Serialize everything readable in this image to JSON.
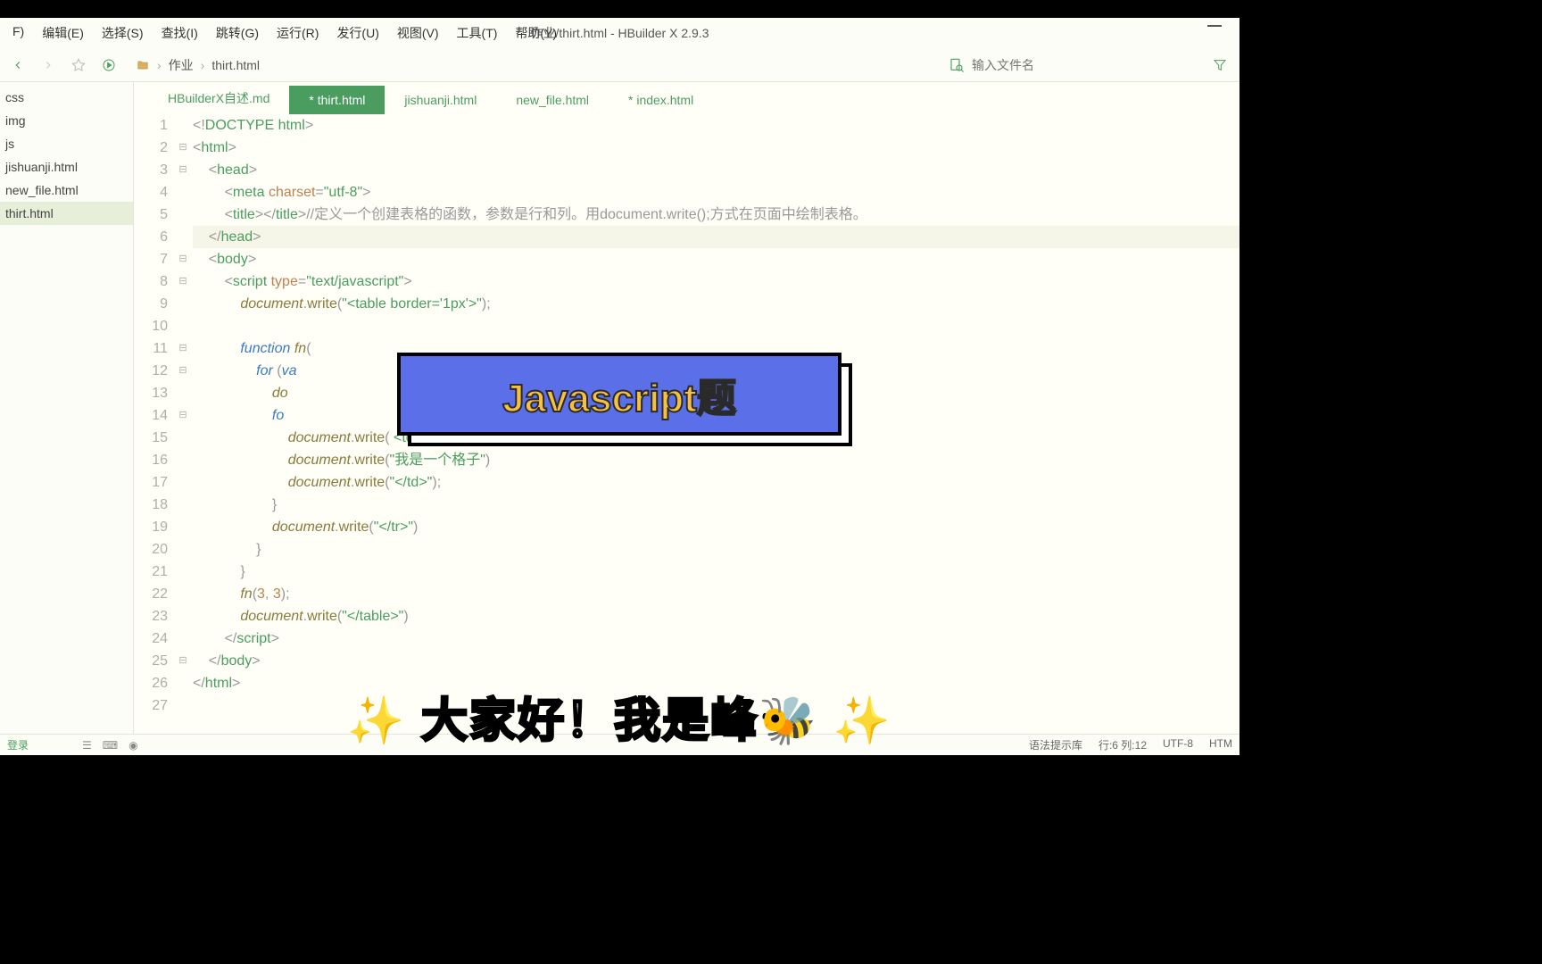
{
  "window": {
    "title": "作业/thirt.html - HBuilder X 2.9.3"
  },
  "menu": [
    "F)",
    "编辑(E)",
    "选择(S)",
    "查找(I)",
    "跳转(G)",
    "运行(R)",
    "发行(U)",
    "视图(V)",
    "工具(T)",
    "帮助(Y)"
  ],
  "breadcrumb": [
    "作业",
    "thirt.html"
  ],
  "search": {
    "placeholder": "输入文件名"
  },
  "sidebar": {
    "items": [
      "css",
      "img",
      "js",
      "jishuanji.html",
      "new_file.html",
      "thirt.html"
    ],
    "active_index": 5
  },
  "tabs": [
    {
      "label": "HBuilderX自述.md",
      "active": false
    },
    {
      "label": "* thirt.html",
      "active": true
    },
    {
      "label": "jishuanji.html",
      "active": false
    },
    {
      "label": "new_file.html",
      "active": false
    },
    {
      "label": "* index.html",
      "active": false
    }
  ],
  "code": {
    "lines": [
      {
        "n": 1,
        "fold": "",
        "html": "<span class='t-punct'>&lt;!</span><span class='t-tag'>DOCTYPE html</span><span class='t-punct'>&gt;</span>"
      },
      {
        "n": 2,
        "fold": "⊟",
        "html": "<span class='t-punct'>&lt;</span><span class='t-tag'>html</span><span class='t-punct'>&gt;</span>"
      },
      {
        "n": 3,
        "fold": "⊟",
        "html": "    <span class='t-punct'>&lt;</span><span class='t-tag'>head</span><span class='t-punct'>&gt;</span>"
      },
      {
        "n": 4,
        "fold": "",
        "html": "        <span class='t-punct'>&lt;</span><span class='t-tag'>meta</span> <span class='t-attr'>charset</span><span class='t-punct'>=</span><span class='t-str'>\"utf-8\"</span><span class='t-punct'>&gt;</span>"
      },
      {
        "n": 5,
        "fold": "",
        "html": "        <span class='t-punct'>&lt;</span><span class='t-tag'>title</span><span class='t-punct'>&gt;&lt;/</span><span class='t-tag'>title</span><span class='t-punct'>&gt;</span><span class='t-comment'>//定义一个创建表格的函数，参数是行和列。用document.write();方式在页面中绘制表格。</span>"
      },
      {
        "n": 6,
        "fold": "",
        "html": "    <span class='t-punct'>&lt;/</span><span class='t-tag'>head</span><span class='t-punct'>&gt;</span>",
        "cursor": true
      },
      {
        "n": 7,
        "fold": "⊟",
        "html": "    <span class='t-punct'>&lt;</span><span class='t-tag'>body</span><span class='t-punct'>&gt;</span>"
      },
      {
        "n": 8,
        "fold": "⊟",
        "html": "        <span class='t-punct'>&lt;</span><span class='t-tag'>script</span> <span class='t-attr'>type</span><span class='t-punct'>=</span><span class='t-str'>\"text/javascript\"</span><span class='t-punct'>&gt;</span>"
      },
      {
        "n": 9,
        "fold": "",
        "html": "            <span class='t-obj'>document</span><span class='t-punct'>.</span><span class='t-method'>write</span><span class='t-punct'>(</span><span class='t-str'>\"&lt;table border='1px'&gt;\"</span><span class='t-punct'>);</span>"
      },
      {
        "n": 10,
        "fold": "",
        "html": ""
      },
      {
        "n": 11,
        "fold": "⊟",
        "html": "            <span class='t-kw'>function</span> <span class='t-func'>fn</span><span class='t-punct'>(</span>"
      },
      {
        "n": 12,
        "fold": "⊟",
        "html": "                <span class='t-kw'>for</span> <span class='t-punct'>(</span><span class='t-kw'>va</span>"
      },
      {
        "n": 13,
        "fold": "",
        "html": "                    <span class='t-obj'>do</span>"
      },
      {
        "n": 14,
        "fold": "⊟",
        "html": "                    <span class='t-kw'>fo</span>"
      },
      {
        "n": 15,
        "fold": "",
        "html": "                        <span class='t-obj'>document</span><span class='t-punct'>.</span><span class='t-method'>write</span><span class='t-punct'>(</span> <span class='t-str'>&lt;td&gt;</span> <span class='t-punct'>);</span>"
      },
      {
        "n": 16,
        "fold": "",
        "html": "                        <span class='t-obj'>document</span><span class='t-punct'>.</span><span class='t-method'>write</span><span class='t-punct'>(</span><span class='t-str'>\"我是一个格子\"</span><span class='t-punct'>)</span>"
      },
      {
        "n": 17,
        "fold": "",
        "html": "                        <span class='t-obj'>document</span><span class='t-punct'>.</span><span class='t-method'>write</span><span class='t-punct'>(</span><span class='t-str'>\"&lt;/td&gt;\"</span><span class='t-punct'>);</span>"
      },
      {
        "n": 18,
        "fold": "",
        "html": "                    <span class='t-punct'>}</span>"
      },
      {
        "n": 19,
        "fold": "",
        "html": "                    <span class='t-obj'>document</span><span class='t-punct'>.</span><span class='t-method'>write</span><span class='t-punct'>(</span><span class='t-str'>\"&lt;/tr&gt;\"</span><span class='t-punct'>)</span>"
      },
      {
        "n": 20,
        "fold": "",
        "html": "                <span class='t-punct'>}</span>"
      },
      {
        "n": 21,
        "fold": "",
        "html": "            <span class='t-punct'>}</span>"
      },
      {
        "n": 22,
        "fold": "",
        "html": "            <span class='t-func'>fn</span><span class='t-punct'>(</span><span class='t-num'>3</span><span class='t-punct'>,</span> <span class='t-num'>3</span><span class='t-punct'>);</span>"
      },
      {
        "n": 23,
        "fold": "",
        "html": "            <span class='t-obj'>document</span><span class='t-punct'>.</span><span class='t-method'>write</span><span class='t-punct'>(</span><span class='t-str'>\"&lt;/table&gt;\"</span><span class='t-punct'>)</span>"
      },
      {
        "n": 24,
        "fold": "",
        "html": "        <span class='t-punct'>&lt;/</span><span class='t-tag'>script</span><span class='t-punct'>&gt;</span>"
      },
      {
        "n": 25,
        "fold": "⊟",
        "html": "    <span class='t-punct'>&lt;/</span><span class='t-tag'>body</span><span class='t-punct'>&gt;</span>"
      },
      {
        "n": 26,
        "fold": "",
        "html": "<span class='t-punct'>&lt;/</span><span class='t-tag'>html</span><span class='t-punct'>&gt;</span>"
      },
      {
        "n": 27,
        "fold": "",
        "html": ""
      }
    ]
  },
  "statusbar": {
    "login": "登录",
    "hint": "语法提示库",
    "pos": "行:6 列:12",
    "enc": "UTF-8",
    "lang": "HTM"
  },
  "overlay": {
    "banner": "Javascript题",
    "caption_pre": "✨ ",
    "caption_text": "大家好！我是峰🐝",
    "caption_post": " ✨"
  }
}
